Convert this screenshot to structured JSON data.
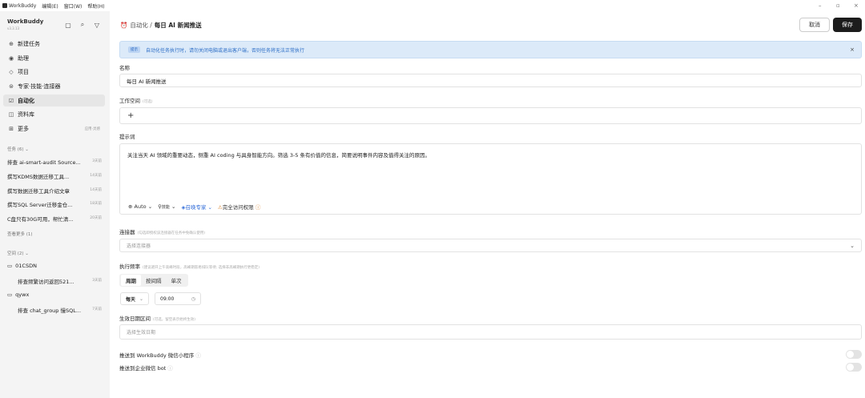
{
  "menubar": {
    "app": "WorkBuddy",
    "menus": [
      "编辑(E)",
      "窗口(W)",
      "帮助(H)"
    ]
  },
  "sidebar": {
    "brand": "WorkBuddy",
    "version": "v3.3.13",
    "nav": [
      {
        "label": "新建任务",
        "icon": "plus-circle-icon"
      },
      {
        "label": "助理",
        "icon": "assistant-icon"
      },
      {
        "label": "项目",
        "icon": "project-icon"
      },
      {
        "label": "专家·技能·连接器",
        "icon": "expert-icon"
      },
      {
        "label": "自动化",
        "icon": "automation-icon"
      },
      {
        "label": "资料库",
        "icon": "library-icon"
      },
      {
        "label": "更多",
        "icon": "grid-icon",
        "right": "应用·灵感"
      }
    ],
    "tasks_header": "任务 (6)",
    "tasks": [
      {
        "title": "排查 ai-smart-audit Source...",
        "time": "3天前"
      },
      {
        "title": "撰写KDMS数据迁移工具...",
        "time": "14天前"
      },
      {
        "title": "撰写数据迁移工具介绍文章",
        "time": "14天前"
      },
      {
        "title": "撰写SQL Server迁移金仓...",
        "time": "18天前"
      },
      {
        "title": "C盘只有30G可用，帮忙清...",
        "time": "20天前"
      }
    ],
    "see_more": "查看更多 (1)",
    "spaces_header": "空间 (2)",
    "spaces": [
      {
        "name": "01CSDN",
        "task": "排查频繁访问返回521...",
        "time": "3天前"
      },
      {
        "name": "qywx",
        "task": "排查 chat_group 慢SQL...",
        "time": "7天前"
      }
    ]
  },
  "header": {
    "crumb_parent": "自动化 /",
    "crumb_title": "每日 AI 新闻推送",
    "cancel": "取消",
    "save": "保存"
  },
  "tip": {
    "badge": "提示",
    "text": "自动化任务执行时，请勿关闭电脑或退出客户端，否则任务将无法正常执行"
  },
  "form": {
    "name_label": "名称",
    "name_value": "每日 AI 新闻推送",
    "workspace_label": "工作空间",
    "workspace_hint": "(可选)",
    "workspace_add": "+",
    "prompt_label": "提示词",
    "prompt_text": "关注当天 AI 领域的重要动态，侧重 AI coding 与具身智能方向。筛选 3-5 条有价值的信息，简要说明事件内容及值得关注的原因。",
    "prompt_tools": {
      "model": "Auto",
      "skill": "技能",
      "expert": "召唤专家",
      "access": "完全访问权限"
    },
    "connector_label": "连接器",
    "connector_hint": "(勾选即授权该连接器在任务中免确认使用)",
    "connector_placeholder": "选择连接器",
    "freq_label": "执行频率",
    "freq_hint": "(建议避开上午高峰时段，高峰期容易排队等待; 选择非高峰期执行更稳定)",
    "freq_tabs": [
      "周期",
      "按间隔",
      "单次"
    ],
    "freq_selected": "周期",
    "period_value": "每天",
    "time_value": "09:00",
    "date_label": "生效日期区间",
    "date_hint": "(可选，留空表示始终生效)",
    "date_placeholder": "选择生效日期",
    "push_wechat": "推送到 WorkBuddy 微信小程序",
    "push_wecom": "推送到企业微信 bot"
  },
  "colors": {
    "accent": "#2f6bd8",
    "tip_bg": "#dceaf9",
    "primary_btn": "#1c1c1c",
    "sidebar_bg": "#f4f4f4"
  }
}
